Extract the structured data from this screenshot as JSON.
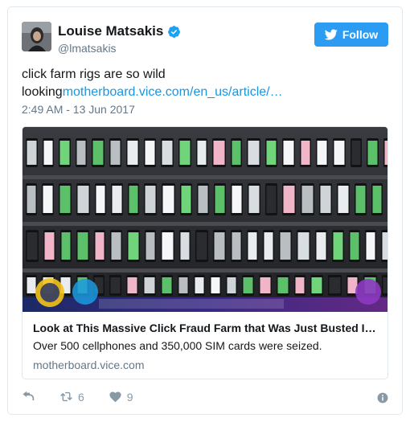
{
  "author": {
    "name": "Louise Matsakis",
    "handle": "@lmatsakis",
    "verified_icon": "verified-badge-icon",
    "avatar_icon": "profile-photo"
  },
  "follow_button": {
    "label": "Follow",
    "icon": "twitter-bird-icon"
  },
  "tweet": {
    "text_line1": "click farm rigs are so wild",
    "text_prefix": "looking",
    "link_text": "motherboard.vice.com/en_us/article/…",
    "timestamp": "2:49 AM - 13 Jun 2017"
  },
  "link_card": {
    "image_desc_icon": "phone-wall-photo",
    "title": "Look at This Massive Click Fraud Farm that Was Just Busted I…",
    "description": "Over 500 cellphones and 350,000 SIM cards were seized.",
    "domain": "motherboard.vice.com"
  },
  "actions": {
    "reply_icon": "reply-icon",
    "retweet_icon": "retweet-icon",
    "retweet_count": "6",
    "like_icon": "heart-icon",
    "like_count": "9",
    "info_icon": "info-icon"
  },
  "colors": {
    "accent": "#1b95e0",
    "follow_bg": "#2b9cf2",
    "muted": "#657786",
    "icon_muted": "#8899a6",
    "border": "#e1e8ed"
  }
}
